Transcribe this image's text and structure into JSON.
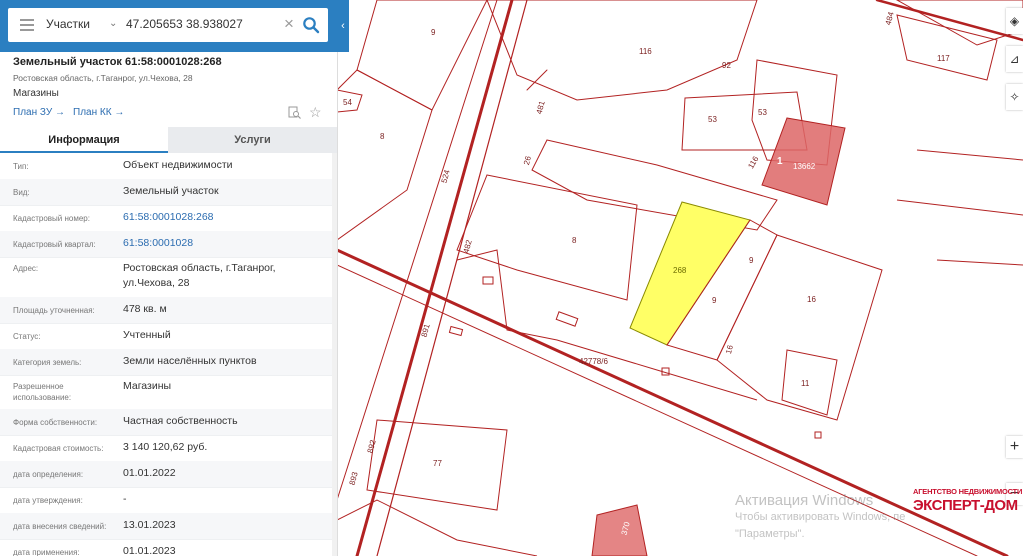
{
  "search": {
    "category": "Участки",
    "query": "47.205653 38.938027"
  },
  "parcel": {
    "title": "Земельный участок 61:58:0001028:268",
    "address_short": "Ростовская область, г.Таганрог, ул.Чехова, 28",
    "use_short": "Магазины",
    "plan_zu": "План ЗУ →",
    "plan_kk": "План КК →"
  },
  "tabs": [
    "Информация",
    "Услуги"
  ],
  "rows": [
    {
      "k": "Тип:",
      "v": "Объект недвижимости"
    },
    {
      "k": "Вид:",
      "v": "Земельный участок"
    },
    {
      "k": "Кадастровый номер:",
      "v": "61:58:0001028:268",
      "link": true
    },
    {
      "k": "Кадастровый квартал:",
      "v": "61:58:0001028",
      "link": true
    },
    {
      "k": "Адрес:",
      "v": "Ростовская область, г.Таганрог, ул.Чехова, 28"
    },
    {
      "k": "Площадь уточненная:",
      "v": "478 кв. м"
    },
    {
      "k": "Статус:",
      "v": "Учтенный"
    },
    {
      "k": "Категория земель:",
      "v": "Земли населённых пунктов"
    },
    {
      "k": "Разрешенное использование:",
      "v": "Магазины"
    },
    {
      "k": "Форма собственности:",
      "v": "Частная собственность"
    },
    {
      "k": "Кадастровая стоимость:",
      "v": "3 140 120,62 руб."
    },
    {
      "k": "дата определения:",
      "v": "01.01.2022"
    },
    {
      "k": "дата утверждения:",
      "v": "-"
    },
    {
      "k": "дата внесения сведений:",
      "v": "13.01.2023"
    },
    {
      "k": "дата применения:",
      "v": "01.01.2023"
    }
  ],
  "map_labels": {
    "l9": "9",
    "l116a": "116",
    "l92": "92",
    "l53a": "53",
    "l53b": "53",
    "l116b": "116",
    "l1": "1",
    "l13662": "13662",
    "l8a": "8",
    "l26": "26",
    "l481": "481",
    "l524": "524",
    "l8b": "8",
    "l482": "482",
    "l268": "268",
    "l9b": "9",
    "l9c": "9",
    "l16a": "16",
    "l16b": "16",
    "l11": "11",
    "l42778": "42778/6",
    "l891": "891",
    "l892": "892",
    "l893": "893",
    "l77": "77",
    "l484": "484",
    "l117": "117",
    "l54": "54",
    "l370": "370"
  },
  "watermark": {
    "line1": "Активация Windows",
    "line2": "Чтобы активировать Windows, пе",
    "line3": "\"Параметры\"."
  },
  "logo": {
    "line1": "АГЕНТСТВО НЕДВИЖИМОСТИ",
    "line2": "ЭКСПЕРТ-ДОМ"
  },
  "colors": {
    "accent": "#2b7fc1",
    "parcel_line": "#b22222",
    "selected_fill": "#ffff66"
  }
}
